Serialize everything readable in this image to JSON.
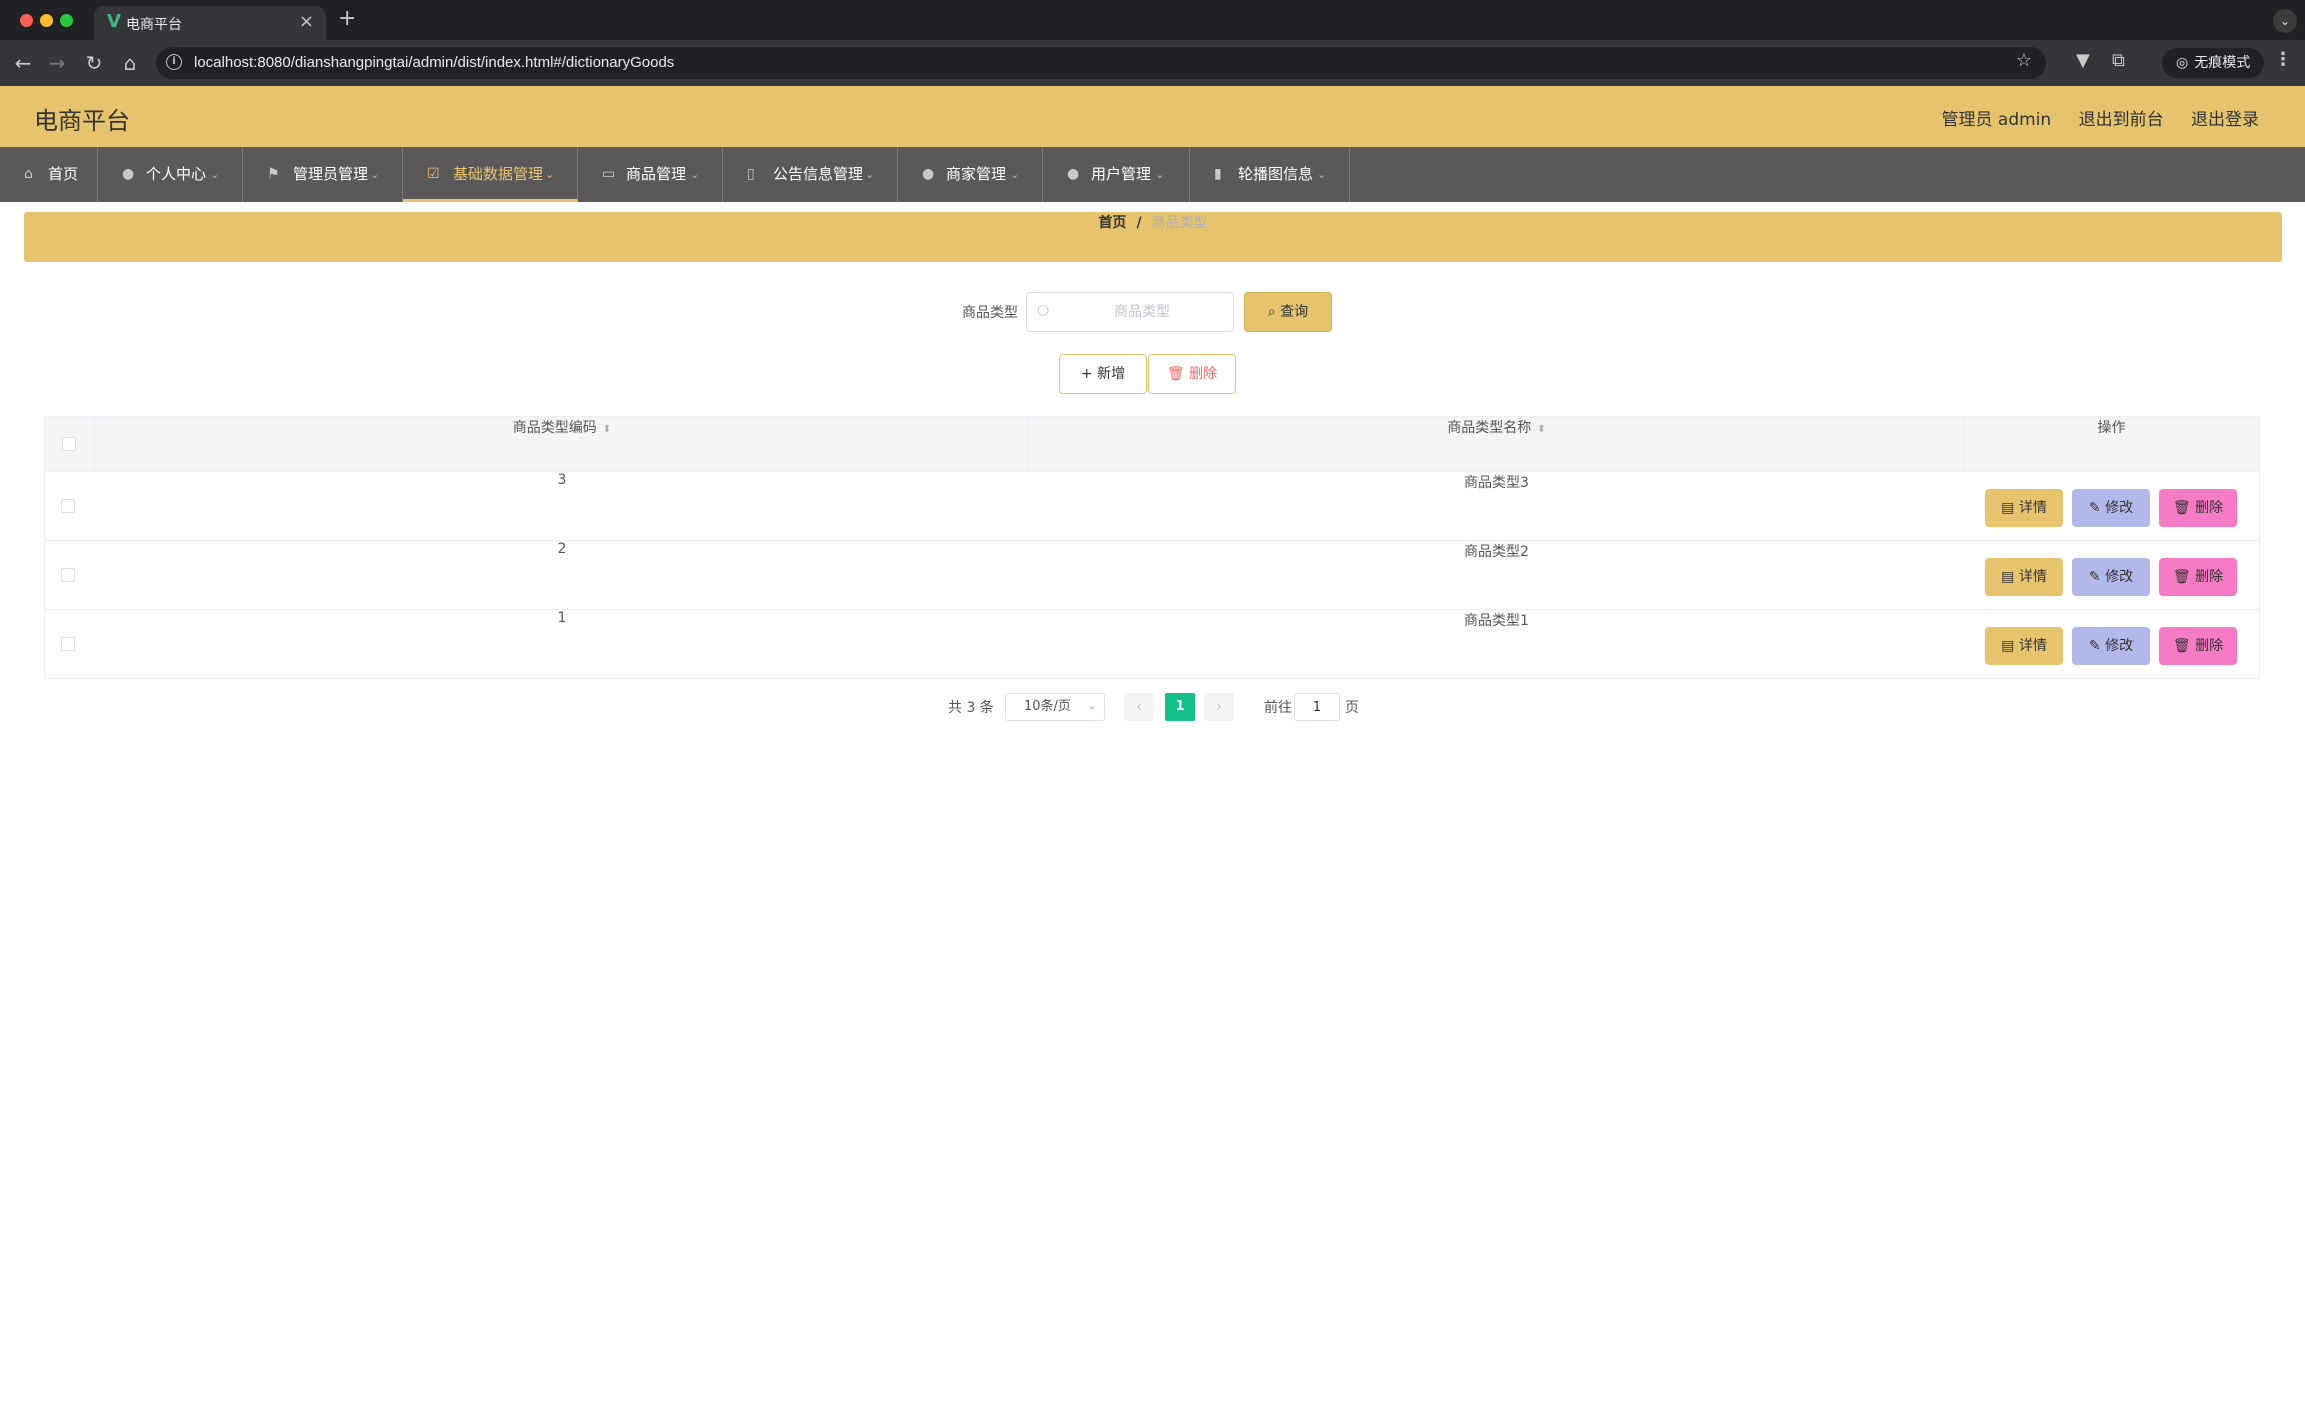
{
  "browser": {
    "tab_title": "电商平台",
    "url": "localhost:8080/dianshangpingtai/admin/dist/index.html#/dictionaryGoods",
    "incognito_label": "无痕模式"
  },
  "header": {
    "title": "电商平台",
    "user": "管理员 admin",
    "to_front": "退出到前台",
    "logout": "退出登录"
  },
  "nav": {
    "items": [
      {
        "label": "首页",
        "icon": "home-icon"
      },
      {
        "label": "个人中心",
        "icon": "user-icon"
      },
      {
        "label": "管理员管理",
        "icon": "flag-icon"
      },
      {
        "label": "基础数据管理",
        "icon": "checkbox-icon",
        "active": true
      },
      {
        "label": "商品管理",
        "icon": "card-icon"
      },
      {
        "label": "公告信息管理",
        "icon": "microphone-icon"
      },
      {
        "label": "商家管理",
        "icon": "location-icon"
      },
      {
        "label": "用户管理",
        "icon": "user-icon"
      },
      {
        "label": "轮播图信息",
        "icon": "chart-icon"
      }
    ]
  },
  "breadcrumb": {
    "home": "首页",
    "separator": "/",
    "current": "商品类型"
  },
  "search": {
    "label": "商品类型",
    "placeholder": "商品类型",
    "button": "查询"
  },
  "actions": {
    "add": "新增",
    "delete": "删除"
  },
  "table": {
    "columns": [
      "商品类型编码",
      "商品类型名称",
      "操作"
    ],
    "rows": [
      {
        "code": "3",
        "name": "商品类型3"
      },
      {
        "code": "2",
        "name": "商品类型2"
      },
      {
        "code": "1",
        "name": "商品类型1"
      }
    ],
    "op_detail": "详情",
    "op_edit": "修改",
    "op_delete": "删除"
  },
  "pagination": {
    "total": "共 3 条",
    "page_size": "10条/页",
    "current_page": "1",
    "goto_label": "前往",
    "goto_value": "1",
    "goto_suffix": "页"
  },
  "colors": {
    "accent": "#e6c46e",
    "nav_bg": "#5a5858",
    "edit_button": "#b3b8ea",
    "delete_button": "#f57bc4",
    "current_page": "#13c08a"
  }
}
